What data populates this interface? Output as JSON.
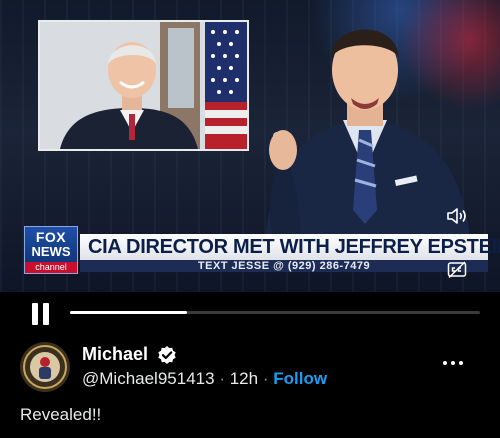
{
  "video": {
    "lower_third": {
      "logo_top": "FOX",
      "logo_bottom": "NEWS",
      "logo_channel": "channel",
      "headline": "CIA DIRECTOR MET WITH JEFFREY EPSTEIN",
      "ticker": "TEXT JESSE @ (929) 286-7479"
    },
    "progress": 0.285,
    "colors": {
      "headline_text": "#0b1f4a",
      "ticker_bg": "#1c2c55",
      "logo_bg": "#1f4fa8",
      "channel_red": "#c8102e"
    }
  },
  "controls": {
    "pause_icon": "pause-icon",
    "volume_icon": "volume-icon",
    "captions_icon": "captions-icon"
  },
  "post": {
    "author_name": "Michael",
    "handle": "@Michael951413",
    "separator": "·",
    "time": "12h",
    "follow_label": "Follow",
    "text": "Revealed!!",
    "accent": "#1d9bf0"
  }
}
